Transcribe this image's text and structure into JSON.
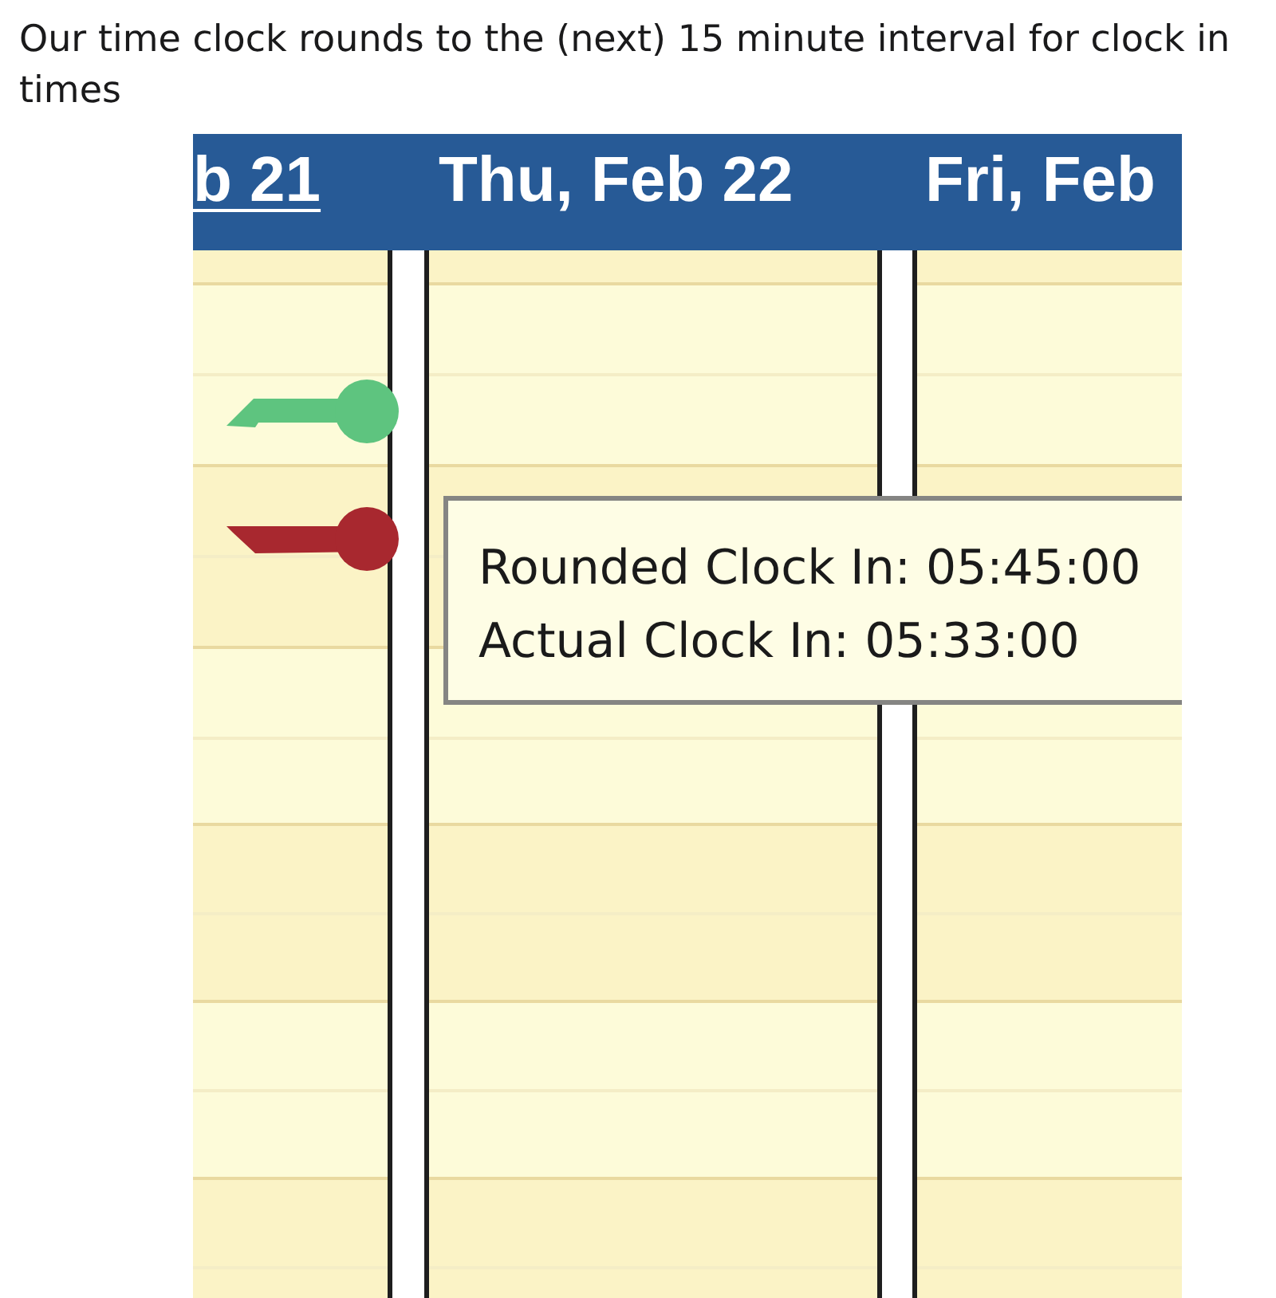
{
  "post": {
    "title": "Our time clock rounds to the (next) 15 minute interval for clock in times"
  },
  "calendar": {
    "days": [
      {
        "label": "b 21",
        "underlined": true
      },
      {
        "label": "Thu, Feb 22",
        "underlined": false
      },
      {
        "label": "Fri, Feb",
        "underlined": false
      }
    ],
    "markers": [
      {
        "color": "#5ec47f"
      },
      {
        "color": "#a8282f"
      }
    ],
    "tooltip": {
      "lines": [
        "Rounded Clock In: 05:45:00",
        "Actual Clock In: 05:33:00"
      ]
    }
  }
}
